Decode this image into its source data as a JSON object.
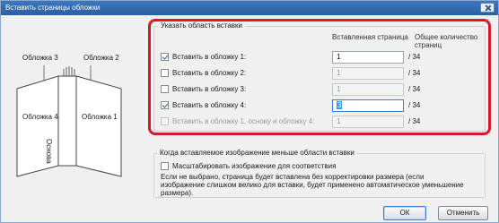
{
  "window": {
    "title": "Вставить страницы обложки"
  },
  "illustration": {
    "cover3": "Обложка 3",
    "cover2": "Обложка 2",
    "cover4": "Обложка 4",
    "cover1": "Обложка 1",
    "spine": "Основа"
  },
  "insert_area": {
    "title": "Указать область вставки",
    "col_inserted": "Вставленная страница",
    "col_total": "Общее количество страниц",
    "rows": [
      {
        "label": "Вставить в обложку 1:",
        "checked": true,
        "enabled": true,
        "value": "1",
        "total": "/ 34"
      },
      {
        "label": "Вставить в обложку 2:",
        "checked": false,
        "enabled": true,
        "value": "1",
        "total": "/ 34"
      },
      {
        "label": "Вставить в обложку 3:",
        "checked": false,
        "enabled": true,
        "value": "1",
        "total": "/ 34"
      },
      {
        "label": "Вставить в обложку 4:",
        "checked": true,
        "enabled": true,
        "value": "3",
        "total": "/ 34"
      },
      {
        "label": "Вставить в обложку 1, основу и обложку 4:",
        "checked": false,
        "enabled": false,
        "value": "1",
        "total": "/ 34"
      }
    ]
  },
  "smaller_group": {
    "title": "Когда вставляемое изображение меньше области вставки",
    "scale_label": "Масштабировать изображение для соответствия",
    "note": "Если не выбрано, страница будет вставлена без корректировки размера (если изображение слишком велико для вставки, будет применено автоматическое уменьшение размера)."
  },
  "buttons": {
    "ok": "ОК",
    "cancel": "Отменить"
  },
  "colors": {
    "highlight": "#d61a2a",
    "titlebar": "#2a5fa3"
  }
}
